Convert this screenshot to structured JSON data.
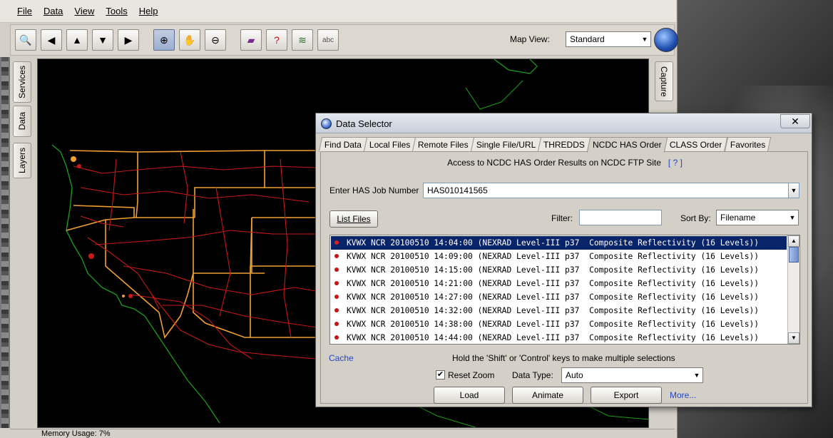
{
  "menu": {
    "file": "File",
    "data": "Data",
    "view": "View",
    "tools": "Tools",
    "help": "Help"
  },
  "toolbar": {
    "map_view_label": "Map View:",
    "map_view_value": "Standard",
    "buttons": [
      "zoom-to-all",
      "pan-left",
      "pan-up",
      "pan-down",
      "pan-right",
      "zoom-in",
      "pan-hand",
      "zoom-out",
      "book",
      "identify",
      "layers",
      "abc-label"
    ],
    "abc_text": "abc"
  },
  "side_tabs": {
    "services": "Services",
    "data": "Data",
    "layers": "Layers",
    "capture": "Capture"
  },
  "status": {
    "memory": "Memory Usage: 7%"
  },
  "dialog": {
    "title": "Data Selector",
    "close": "✕",
    "tabs": [
      "Find Data",
      "Local Files",
      "Remote Files",
      "Single File/URL",
      "THREDDS",
      "NCDC HAS Order",
      "CLASS Order",
      "Favorites"
    ],
    "active_tab": "NCDC HAS Order",
    "access_text": "Access to NCDC HAS Order Results on NCDC FTP Site",
    "help_link": "[ ? ]",
    "job_label": "Enter HAS Job Number",
    "job_value": "HAS010141565",
    "list_files": "List Files",
    "filter_label": "Filter:",
    "filter_value": "",
    "sort_label": "Sort By:",
    "sort_value": "Filename",
    "files": [
      "KVWX NCR 20100510 14:04:00 (NEXRAD Level-III p37  Composite Reflectivity (16 Levels))",
      "KVWX NCR 20100510 14:09:00 (NEXRAD Level-III p37  Composite Reflectivity (16 Levels))",
      "KVWX NCR 20100510 14:15:00 (NEXRAD Level-III p37  Composite Reflectivity (16 Levels))",
      "KVWX NCR 20100510 14:21:00 (NEXRAD Level-III p37  Composite Reflectivity (16 Levels))",
      "KVWX NCR 20100510 14:27:00 (NEXRAD Level-III p37  Composite Reflectivity (16 Levels))",
      "KVWX NCR 20100510 14:32:00 (NEXRAD Level-III p37  Composite Reflectivity (16 Levels))",
      "KVWX NCR 20100510 14:38:00 (NEXRAD Level-III p37  Composite Reflectivity (16 Levels))",
      "KVWX NCR 20100510 14:44:00 (NEXRAD Level-III p37  Composite Reflectivity (16 Levels))"
    ],
    "selected_index": 0,
    "cache": "Cache",
    "hint": "Hold the 'Shift' or 'Control' keys to make multiple selections",
    "reset_zoom": "Reset Zoom",
    "reset_zoom_checked": true,
    "data_type_label": "Data Type:",
    "data_type_value": "Auto",
    "load": "Load",
    "animate": "Animate",
    "export": "Export",
    "more": "More..."
  },
  "colors": {
    "selection": "#0a246a",
    "link": "#2146c8",
    "map_bg": "#000000",
    "state_lines": "#f0a030",
    "roads": "#c81818",
    "coast": "#1aa11a"
  }
}
